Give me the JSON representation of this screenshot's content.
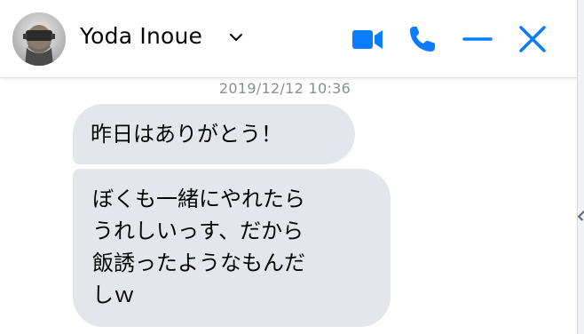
{
  "header": {
    "contact_name": "Yoda Inoue",
    "icons": {
      "avatar": "profile-photo",
      "dropdown": "chevron-down-icon",
      "video": "video-camera-icon",
      "call": "phone-icon",
      "minimize": "minimize-icon",
      "close": "close-icon"
    }
  },
  "conversation": {
    "timestamp": "2019/12/12 10:36",
    "messages": [
      {
        "text": "昨日はありがとう！"
      },
      {
        "text": "ぼくも一緒にやれたら\nうれしいっす、だから\n飯誘ったようなもんだ\nしｗ"
      }
    ]
  },
  "colors": {
    "accent": "#0a7cff",
    "bubble_bg": "#e4e6eb",
    "text": "#050505",
    "timestamp": "#8a8d91"
  }
}
